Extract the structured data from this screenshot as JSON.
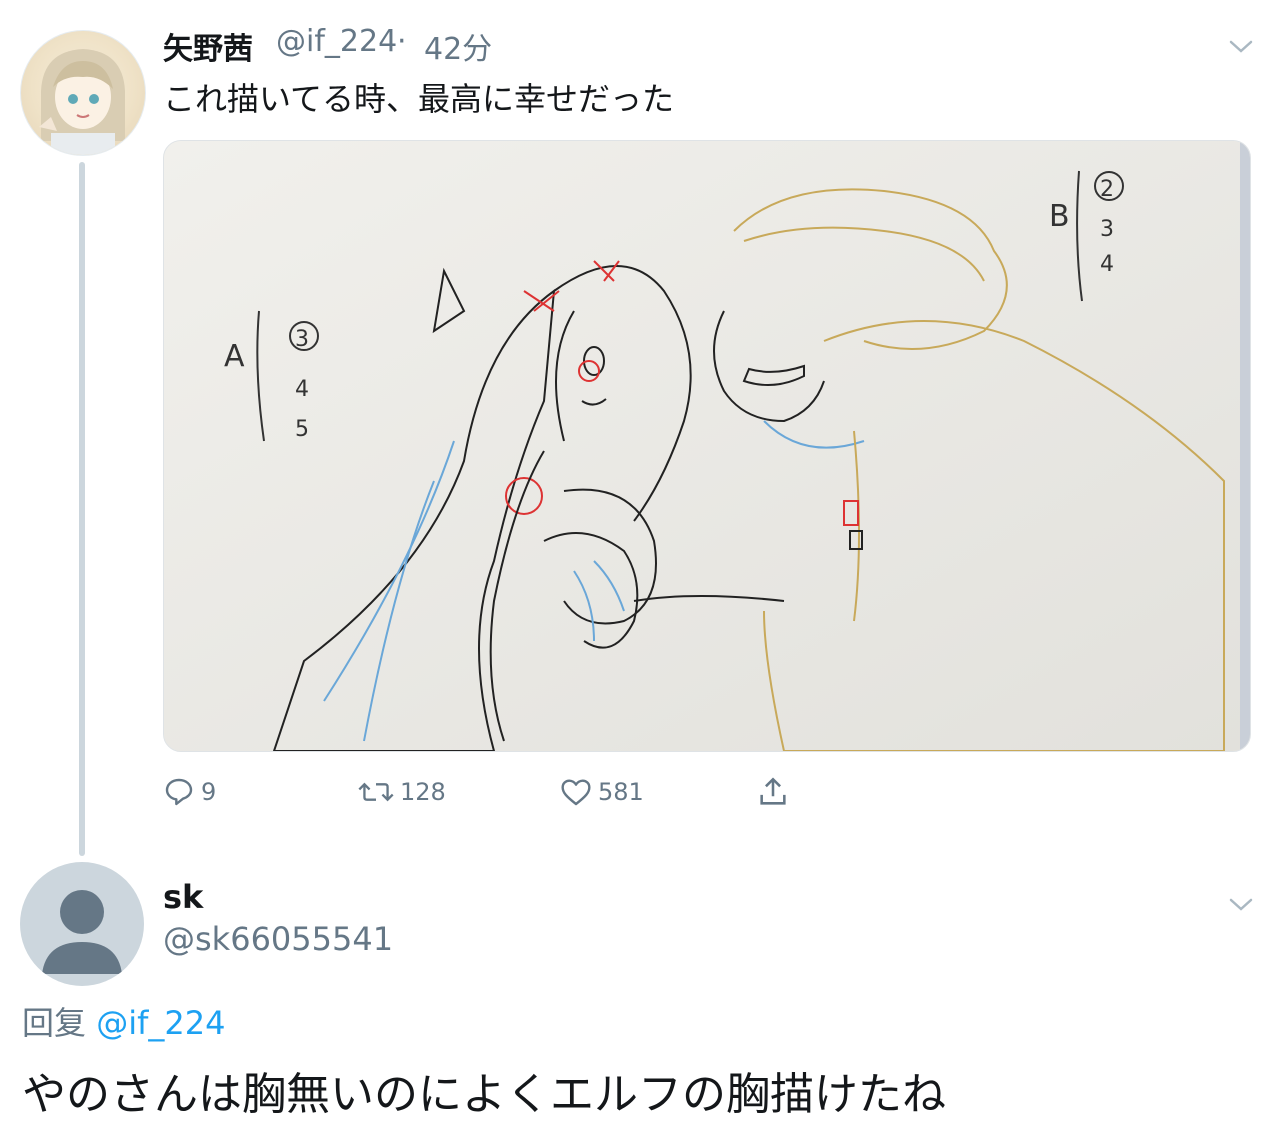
{
  "tweet": {
    "author_name": "矢野茜",
    "author_handle": "@if_224",
    "separator": "·",
    "time": "42分",
    "text": "これ描いてる時、最高に幸せだった",
    "actions": {
      "replies": "9",
      "retweets": "128",
      "likes": "581"
    }
  },
  "reply": {
    "author_name": "sk",
    "author_handle": "@sk66055541",
    "reply_prefix": "回复",
    "reply_to": "@if_224",
    "text": "やのさんは胸無いのによくエルフの胸描けたね"
  },
  "sketch_labels": {
    "left_label": "A",
    "left_numbers": [
      "3",
      "4",
      "5"
    ],
    "right_label": "B",
    "right_numbers": [
      "2",
      "3",
      "4"
    ]
  },
  "colors": {
    "link": "#1da1f2",
    "secondary": "#657786"
  }
}
